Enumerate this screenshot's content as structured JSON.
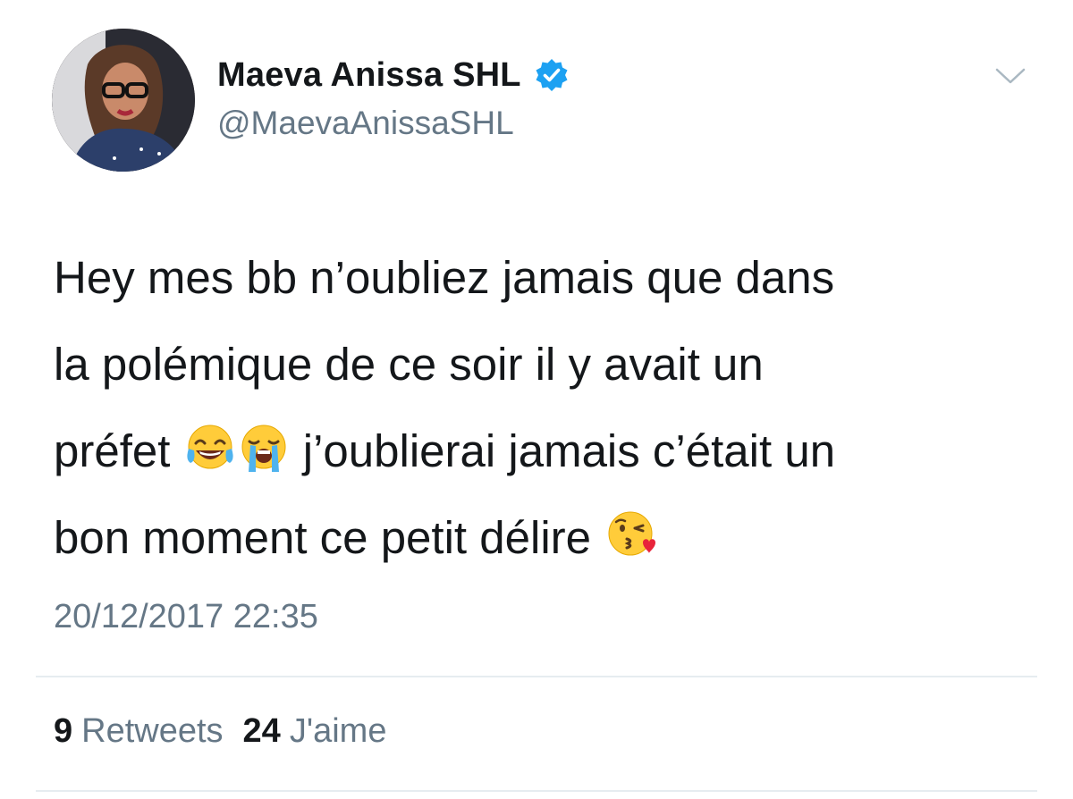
{
  "user": {
    "display_name": "Maeva Anissa SHL",
    "handle": "@MaevaAnissaSHL",
    "verified": true
  },
  "tweet": {
    "lines": [
      [
        "Hey mes bb n’oubliez jamais que dans"
      ],
      [
        "la polémique de ce soir il y avait un"
      ],
      [
        "préfet ",
        "{emoji:face-with-tears-of-joy}",
        "{emoji:loudly-crying-face}",
        " j’oublierai jamais c’était un"
      ],
      [
        "bon moment ce petit délire ",
        "{emoji:face-blowing-a-kiss}"
      ]
    ],
    "timestamp": "20/12/2017 22:35"
  },
  "stats": {
    "retweets_count": "9",
    "retweets_label": "Retweets",
    "likes_count": "24",
    "likes_label": "J'aime"
  },
  "colors": {
    "verified": "#1da1f2",
    "secondary_text": "#657786",
    "primary_text": "#14171a",
    "divider": "#e6ecf0"
  },
  "icons": [
    "verified-badge-icon",
    "chevron-down-icon"
  ]
}
